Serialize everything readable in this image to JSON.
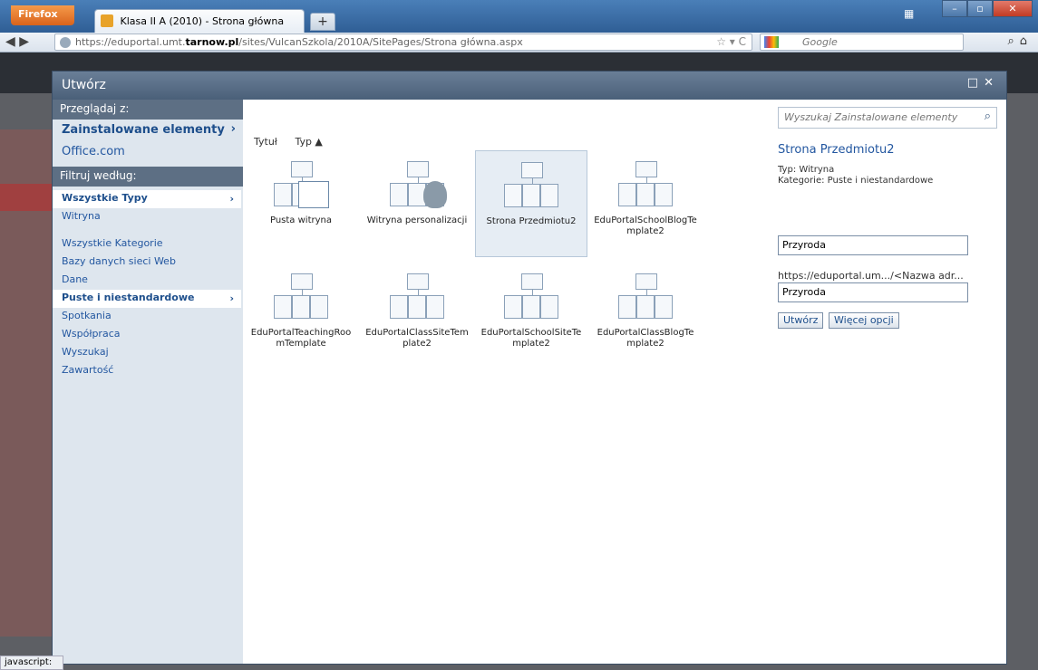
{
  "browser": {
    "menu_label": "Firefox",
    "tab_title": "Klasa II A (2010) - Strona główna",
    "new_tab": "+",
    "url_prefix": "https://eduportal.umt.",
    "url_domain": "tarnow.pl",
    "url_suffix": "/sites/VulcanSzkola/2010A/SitePages/Strona główna.aspx",
    "search_placeholder": "Google"
  },
  "dialog": {
    "title": "Utwórz",
    "browse_header": "Przeglądaj z:",
    "sources": [
      {
        "label": "Zainstalowane elementy"
      },
      {
        "label": "Office.com"
      }
    ],
    "filter_header": "Filtruj według:",
    "types": [
      {
        "label": "Wszystkie Typy"
      },
      {
        "label": "Witryna"
      }
    ],
    "categories": [
      {
        "label": "Wszystkie Kategorie"
      },
      {
        "label": "Bazy danych sieci Web"
      },
      {
        "label": "Dane"
      },
      {
        "label": "Puste i niestandardowe"
      },
      {
        "label": "Spotkania"
      },
      {
        "label": "Współpraca"
      },
      {
        "label": "Wyszukaj"
      },
      {
        "label": "Zawartość"
      }
    ],
    "sort": {
      "title": "Tytuł",
      "type": "Typ ▲"
    },
    "templates": [
      {
        "label": "Pusta witryna"
      },
      {
        "label": "Witryna personalizacji"
      },
      {
        "label": "Strona Przedmiotu2"
      },
      {
        "label": "EduPortalSchoolBlogTemplate2"
      },
      {
        "label": "EduPortalTeachingRoomTemplate"
      },
      {
        "label": "EduPortalClassSiteTemplate2"
      },
      {
        "label": "EduPortalSchoolSiteTemplate2"
      },
      {
        "label": "EduPortalClassBlogTemplate2"
      }
    ],
    "details": {
      "search_placeholder": "Wyszukaj Zainstalowane elementy",
      "selected_title": "Strona Przedmiotu2",
      "type_line": "Typ: Witryna",
      "category_line": "Kategorie: Puste i niestandardowe",
      "name_value": "Przyroda",
      "url_label": "https://eduportal.um.../<Nazwa adr...",
      "url_value": "Przyroda",
      "create_button": "Utwórz",
      "more_options_button": "Więcej opcji"
    }
  },
  "status": {
    "text": "javascript:"
  }
}
